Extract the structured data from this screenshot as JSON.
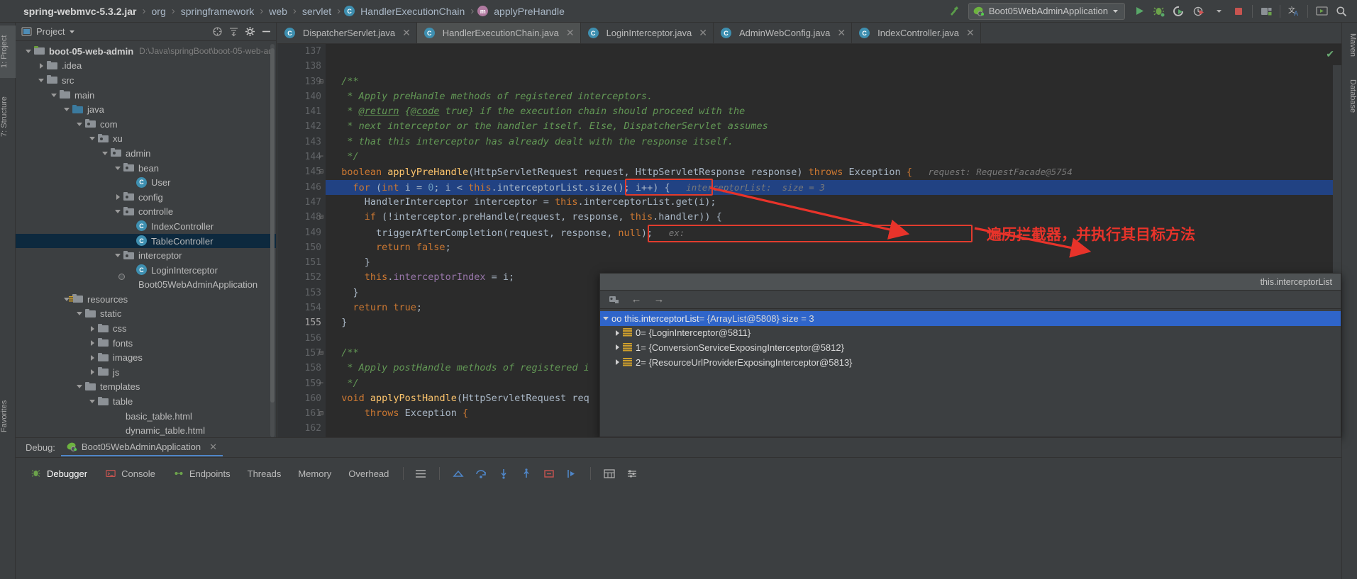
{
  "topbar": {
    "breadcrumbs": [
      {
        "label": "spring-webmvc-5.3.2.jar",
        "bold": true,
        "icon": ""
      },
      {
        "label": "org",
        "bold": false,
        "icon": ""
      },
      {
        "label": "springframework",
        "bold": false,
        "icon": ""
      },
      {
        "label": "web",
        "bold": false,
        "icon": ""
      },
      {
        "label": "servlet",
        "bold": false,
        "icon": ""
      },
      {
        "label": "HandlerExecutionChain",
        "bold": false,
        "icon": "class-icon"
      },
      {
        "label": "applyPreHandle",
        "bold": false,
        "icon": "method-icon"
      }
    ],
    "run_config": "Boot05WebAdminApplication",
    "buttons": [
      {
        "name": "build-hammer-icon"
      },
      {
        "name": "run-icon"
      },
      {
        "name": "debug-icon"
      },
      {
        "name": "run-coverage-icon"
      },
      {
        "name": "profiler-icon"
      },
      {
        "name": "stop-icon"
      },
      {
        "name": "project-structure-icon"
      },
      {
        "name": "translate-icon"
      },
      {
        "name": "presentation-icon"
      },
      {
        "name": "search-everywhere-icon"
      }
    ]
  },
  "left_strip": {
    "tabs": [
      {
        "label": "1: Project",
        "active": true
      },
      {
        "label": "7: Structure",
        "active": false
      }
    ],
    "bottom_label": "Favorites"
  },
  "right_strip": {
    "tabs": [
      {
        "label": "Maven"
      },
      {
        "label": "Database"
      }
    ]
  },
  "project_panel": {
    "title": "Project",
    "header_icons": [
      "collapse-target-icon",
      "flatten-packages-icon",
      "settings-gear-icon",
      "hide-panel-icon"
    ],
    "tree": [
      {
        "depth": 0,
        "label": "boot-05-web-admin",
        "sub": "D:\\Java\\springBoot\\boot-05-web-ad",
        "icon": "module-folder-icon",
        "twisty": "open",
        "bold": true,
        "selected": false
      },
      {
        "depth": 1,
        "label": ".idea",
        "sub": "",
        "icon": "folder-icon",
        "twisty": "closed",
        "bold": false,
        "selected": false
      },
      {
        "depth": 1,
        "label": "src",
        "sub": "",
        "icon": "folder-icon",
        "twisty": "open",
        "bold": false,
        "selected": false
      },
      {
        "depth": 2,
        "label": "main",
        "sub": "",
        "icon": "folder-icon",
        "twisty": "open",
        "bold": false,
        "selected": false
      },
      {
        "depth": 3,
        "label": "java",
        "sub": "",
        "icon": "source-folder-icon",
        "twisty": "open",
        "bold": false,
        "selected": false
      },
      {
        "depth": 4,
        "label": "com",
        "sub": "",
        "icon": "package-icon",
        "twisty": "open",
        "bold": false,
        "selected": false
      },
      {
        "depth": 5,
        "label": "xu",
        "sub": "",
        "icon": "package-icon",
        "twisty": "open",
        "bold": false,
        "selected": false
      },
      {
        "depth": 6,
        "label": "admin",
        "sub": "",
        "icon": "package-icon",
        "twisty": "open",
        "bold": false,
        "selected": false
      },
      {
        "depth": 7,
        "label": "bean",
        "sub": "",
        "icon": "package-icon",
        "twisty": "open",
        "bold": false,
        "selected": false
      },
      {
        "depth": 8,
        "label": "User",
        "sub": "",
        "icon": "class-icon",
        "twisty": "none",
        "bold": false,
        "selected": false
      },
      {
        "depth": 7,
        "label": "config",
        "sub": "",
        "icon": "package-icon",
        "twisty": "closed",
        "bold": false,
        "selected": false
      },
      {
        "depth": 7,
        "label": "controlle",
        "sub": "",
        "icon": "package-icon",
        "twisty": "open",
        "bold": false,
        "selected": false
      },
      {
        "depth": 8,
        "label": "IndexController",
        "sub": "",
        "icon": "class-icon",
        "twisty": "none",
        "bold": false,
        "selected": false
      },
      {
        "depth": 8,
        "label": "TableController",
        "sub": "",
        "icon": "class-icon",
        "twisty": "none",
        "bold": false,
        "selected": true
      },
      {
        "depth": 7,
        "label": "interceptor",
        "sub": "",
        "icon": "package-icon",
        "twisty": "open",
        "bold": false,
        "selected": false
      },
      {
        "depth": 8,
        "label": "LoginInterceptor",
        "sub": "",
        "icon": "class-icon",
        "twisty": "none",
        "bold": false,
        "selected": false
      },
      {
        "depth": 7,
        "label": "Boot05WebAdminApplication",
        "sub": "",
        "icon": "spring-boot-icon",
        "twisty": "none",
        "bold": false,
        "selected": false
      },
      {
        "depth": 3,
        "label": "resources",
        "sub": "",
        "icon": "resources-folder-icon",
        "twisty": "open",
        "bold": false,
        "selected": false
      },
      {
        "depth": 4,
        "label": "static",
        "sub": "",
        "icon": "folder-icon",
        "twisty": "open",
        "bold": false,
        "selected": false
      },
      {
        "depth": 5,
        "label": "css",
        "sub": "",
        "icon": "folder-icon",
        "twisty": "closed",
        "bold": false,
        "selected": false
      },
      {
        "depth": 5,
        "label": "fonts",
        "sub": "",
        "icon": "folder-icon",
        "twisty": "closed",
        "bold": false,
        "selected": false
      },
      {
        "depth": 5,
        "label": "images",
        "sub": "",
        "icon": "folder-icon",
        "twisty": "closed",
        "bold": false,
        "selected": false
      },
      {
        "depth": 5,
        "label": "js",
        "sub": "",
        "icon": "folder-icon",
        "twisty": "closed",
        "bold": false,
        "selected": false
      },
      {
        "depth": 4,
        "label": "templates",
        "sub": "",
        "icon": "folder-icon",
        "twisty": "open",
        "bold": false,
        "selected": false
      },
      {
        "depth": 5,
        "label": "table",
        "sub": "",
        "icon": "folder-icon",
        "twisty": "open",
        "bold": false,
        "selected": false
      },
      {
        "depth": 6,
        "label": "basic_table.html",
        "sub": "",
        "icon": "html-file-icon",
        "twisty": "none",
        "bold": false,
        "selected": false
      },
      {
        "depth": 6,
        "label": "dynamic_table.html",
        "sub": "",
        "icon": "html-file-icon",
        "twisty": "none",
        "bold": false,
        "selected": false
      }
    ]
  },
  "editor": {
    "tabs": [
      {
        "label": "DispatcherServlet.java",
        "active": false,
        "icon": "class-readonly-icon"
      },
      {
        "label": "HandlerExecutionChain.java",
        "active": true,
        "icon": "class-readonly-icon"
      },
      {
        "label": "LoginInterceptor.java",
        "active": false,
        "icon": "class-icon"
      },
      {
        "label": "AdminWebConfig.java",
        "active": false,
        "icon": "class-icon"
      },
      {
        "label": "IndexController.java",
        "active": false,
        "icon": "class-icon"
      }
    ],
    "first_line_number": 137,
    "current_line": 155,
    "breakpoint_line": 146,
    "lines": [
      {
        "n": 137,
        "tokens": []
      },
      {
        "n": 138,
        "tokens": []
      },
      {
        "n": 139,
        "fold": "open",
        "tokens": [
          {
            "t": "  /**",
            "c": "cmt"
          }
        ]
      },
      {
        "n": 140,
        "tokens": [
          {
            "t": "   * Apply preHandle methods of registered interceptors.",
            "c": "cmt"
          }
        ]
      },
      {
        "n": 141,
        "tokens": [
          {
            "t": "   * ",
            "c": "cmt"
          },
          {
            "t": "@return",
            "c": "cmt-tag"
          },
          {
            "t": " {",
            "c": "cmt"
          },
          {
            "t": "@code",
            "c": "cmt-tag"
          },
          {
            "t": " true} if the execution chain should proceed with the",
            "c": "cmt"
          }
        ]
      },
      {
        "n": 142,
        "tokens": [
          {
            "t": "   * next interceptor or the handler itself. Else, DispatcherServlet assumes",
            "c": "cmt"
          }
        ]
      },
      {
        "n": 143,
        "tokens": [
          {
            "t": "   * that this interceptor has already dealt with the response itself.",
            "c": "cmt"
          }
        ]
      },
      {
        "n": 144,
        "fold": "end",
        "tokens": [
          {
            "t": "   */",
            "c": "cmt"
          }
        ]
      },
      {
        "n": 145,
        "fold": "open",
        "tokens": [
          {
            "t": "  boolean ",
            "c": "kw"
          },
          {
            "t": "applyPreHandle",
            "c": "mth"
          },
          {
            "t": "(HttpServletRequest request, HttpServletResponse response) ",
            "c": "pln"
          },
          {
            "t": "throws ",
            "c": "kw"
          },
          {
            "t": "Exception ",
            "c": "pln"
          },
          {
            "t": "{",
            "c": "kw"
          }
        ]
      },
      {
        "n": 146,
        "highlight": true,
        "tokens": [
          {
            "t": "    for ",
            "c": "kw"
          },
          {
            "t": "(",
            "c": "pln"
          },
          {
            "t": "int ",
            "c": "kw"
          },
          {
            "t": "i = ",
            "c": "pln"
          },
          {
            "t": "0",
            "c": "num"
          },
          {
            "t": "; i < ",
            "c": "pln"
          },
          {
            "t": "this",
            "c": "kw"
          },
          {
            "t": ".interceptorList.size(); i++) {",
            "c": "pln"
          }
        ]
      },
      {
        "n": 147,
        "tokens": [
          {
            "t": "      HandlerInterceptor interceptor = ",
            "c": "pln"
          },
          {
            "t": "this",
            "c": "kw"
          },
          {
            "t": ".interceptorList.get(i);",
            "c": "pln"
          }
        ]
      },
      {
        "n": 148,
        "fold": "open",
        "tokens": [
          {
            "t": "      if ",
            "c": "kw"
          },
          {
            "t": "(!interceptor.preHandle(request, response, ",
            "c": "pln"
          },
          {
            "t": "this",
            "c": "kw"
          },
          {
            "t": ".handler)) {",
            "c": "pln"
          }
        ]
      },
      {
        "n": 149,
        "tokens": [
          {
            "t": "        triggerAfterCompletion(request, response, ",
            "c": "pln"
          },
          {
            "t": "null",
            "c": "kw"
          },
          {
            "t": ");",
            "c": "pln"
          }
        ]
      },
      {
        "n": 150,
        "tokens": [
          {
            "t": "        return false",
            "c": "kw"
          },
          {
            "t": ";",
            "c": "pln"
          }
        ]
      },
      {
        "n": 151,
        "tokens": [
          {
            "t": "      }",
            "c": "pln"
          }
        ]
      },
      {
        "n": 152,
        "tokens": [
          {
            "t": "      this",
            "c": "kw"
          },
          {
            "t": ".",
            "c": "pln"
          },
          {
            "t": "interceptorIndex",
            "c": "fld"
          },
          {
            "t": " = i;",
            "c": "pln"
          }
        ]
      },
      {
        "n": 153,
        "tokens": [
          {
            "t": "    }",
            "c": "pln"
          }
        ]
      },
      {
        "n": 154,
        "tokens": [
          {
            "t": "    return true",
            "c": "kw"
          },
          {
            "t": ";",
            "c": "pln"
          }
        ]
      },
      {
        "n": 155,
        "tokens": [
          {
            "t": "  }",
            "c": "pln"
          }
        ]
      },
      {
        "n": 156,
        "tokens": []
      },
      {
        "n": 157,
        "fold": "open",
        "tokens": [
          {
            "t": "  /**",
            "c": "cmt"
          }
        ]
      },
      {
        "n": 158,
        "tokens": [
          {
            "t": "   * Apply postHandle methods of registered i",
            "c": "cmt"
          }
        ]
      },
      {
        "n": 159,
        "fold": "end",
        "tokens": [
          {
            "t": "   */",
            "c": "cmt"
          }
        ]
      },
      {
        "n": 160,
        "tokens": [
          {
            "t": "  void ",
            "c": "kw"
          },
          {
            "t": "applyPostHandle",
            "c": "mth"
          },
          {
            "t": "(HttpServletRequest req",
            "c": "pln"
          }
        ]
      },
      {
        "n": 161,
        "fold": "open",
        "tokens": [
          {
            "t": "      throws ",
            "c": "kw"
          },
          {
            "t": "Exception ",
            "c": "pln"
          },
          {
            "t": "{",
            "c": "kw"
          }
        ]
      },
      {
        "n": 162,
        "tokens": []
      }
    ],
    "inlay_hints": [
      {
        "line": 145,
        "text": "request: RequestFacade@5754"
      },
      {
        "line": 146,
        "text": "interceptorList:  size = 3"
      },
      {
        "line": 149,
        "text": "ex:"
      }
    ],
    "annotation_text": "遍历拦截器，并执行其目标方法"
  },
  "inspect_window": {
    "title": "this.interceptorList",
    "toolbar_icons": [
      "evaluate-expression-icon",
      "back-arrow-icon",
      "forward-arrow-icon"
    ],
    "root": {
      "label": "oo this.interceptorList",
      "value": "= {ArrayList@5808}  size = 3"
    },
    "children": [
      {
        "index": "0",
        "value": "= {LoginInterceptor@5811}"
      },
      {
        "index": "1",
        "value": "= {ConversionServiceExposingInterceptor@5812}"
      },
      {
        "index": "2",
        "value": "= {ResourceUrlProviderExposingInterceptor@5813}"
      }
    ]
  },
  "debug_panel": {
    "label": "Debug:",
    "session_tab": "Boot05WebAdminApplication",
    "tabs": [
      {
        "label": "Debugger",
        "icon": "debugger-icon",
        "active": true
      },
      {
        "label": "Console",
        "icon": "console-icon",
        "active": false
      },
      {
        "label": "Endpoints",
        "icon": "endpoints-icon",
        "active": false
      },
      {
        "label": "Threads",
        "icon": "",
        "active": false
      },
      {
        "label": "Memory",
        "icon": "",
        "active": false
      },
      {
        "label": "Overhead",
        "icon": "",
        "active": false
      }
    ],
    "action_icons": [
      "layout-icon",
      "show-execution-point-icon",
      "step-over-icon",
      "step-into-icon",
      "step-out-icon",
      "drop-frame-icon",
      "run-to-cursor-icon",
      "evaluate-icon",
      "settings-icon"
    ]
  },
  "colors": {
    "accent_blue": "#3e8fb0",
    "selection_blue": "#214283",
    "annotation_red": "#e8332a",
    "editor_bg": "#2b2b2b",
    "panel_bg": "#3c3f41",
    "keyword_orange": "#cc7832",
    "comment_green": "#629755",
    "string_green": "#6a8759",
    "field_purple": "#9876aa",
    "method_yellow": "#ffc66d",
    "number_blue": "#6897bb"
  }
}
